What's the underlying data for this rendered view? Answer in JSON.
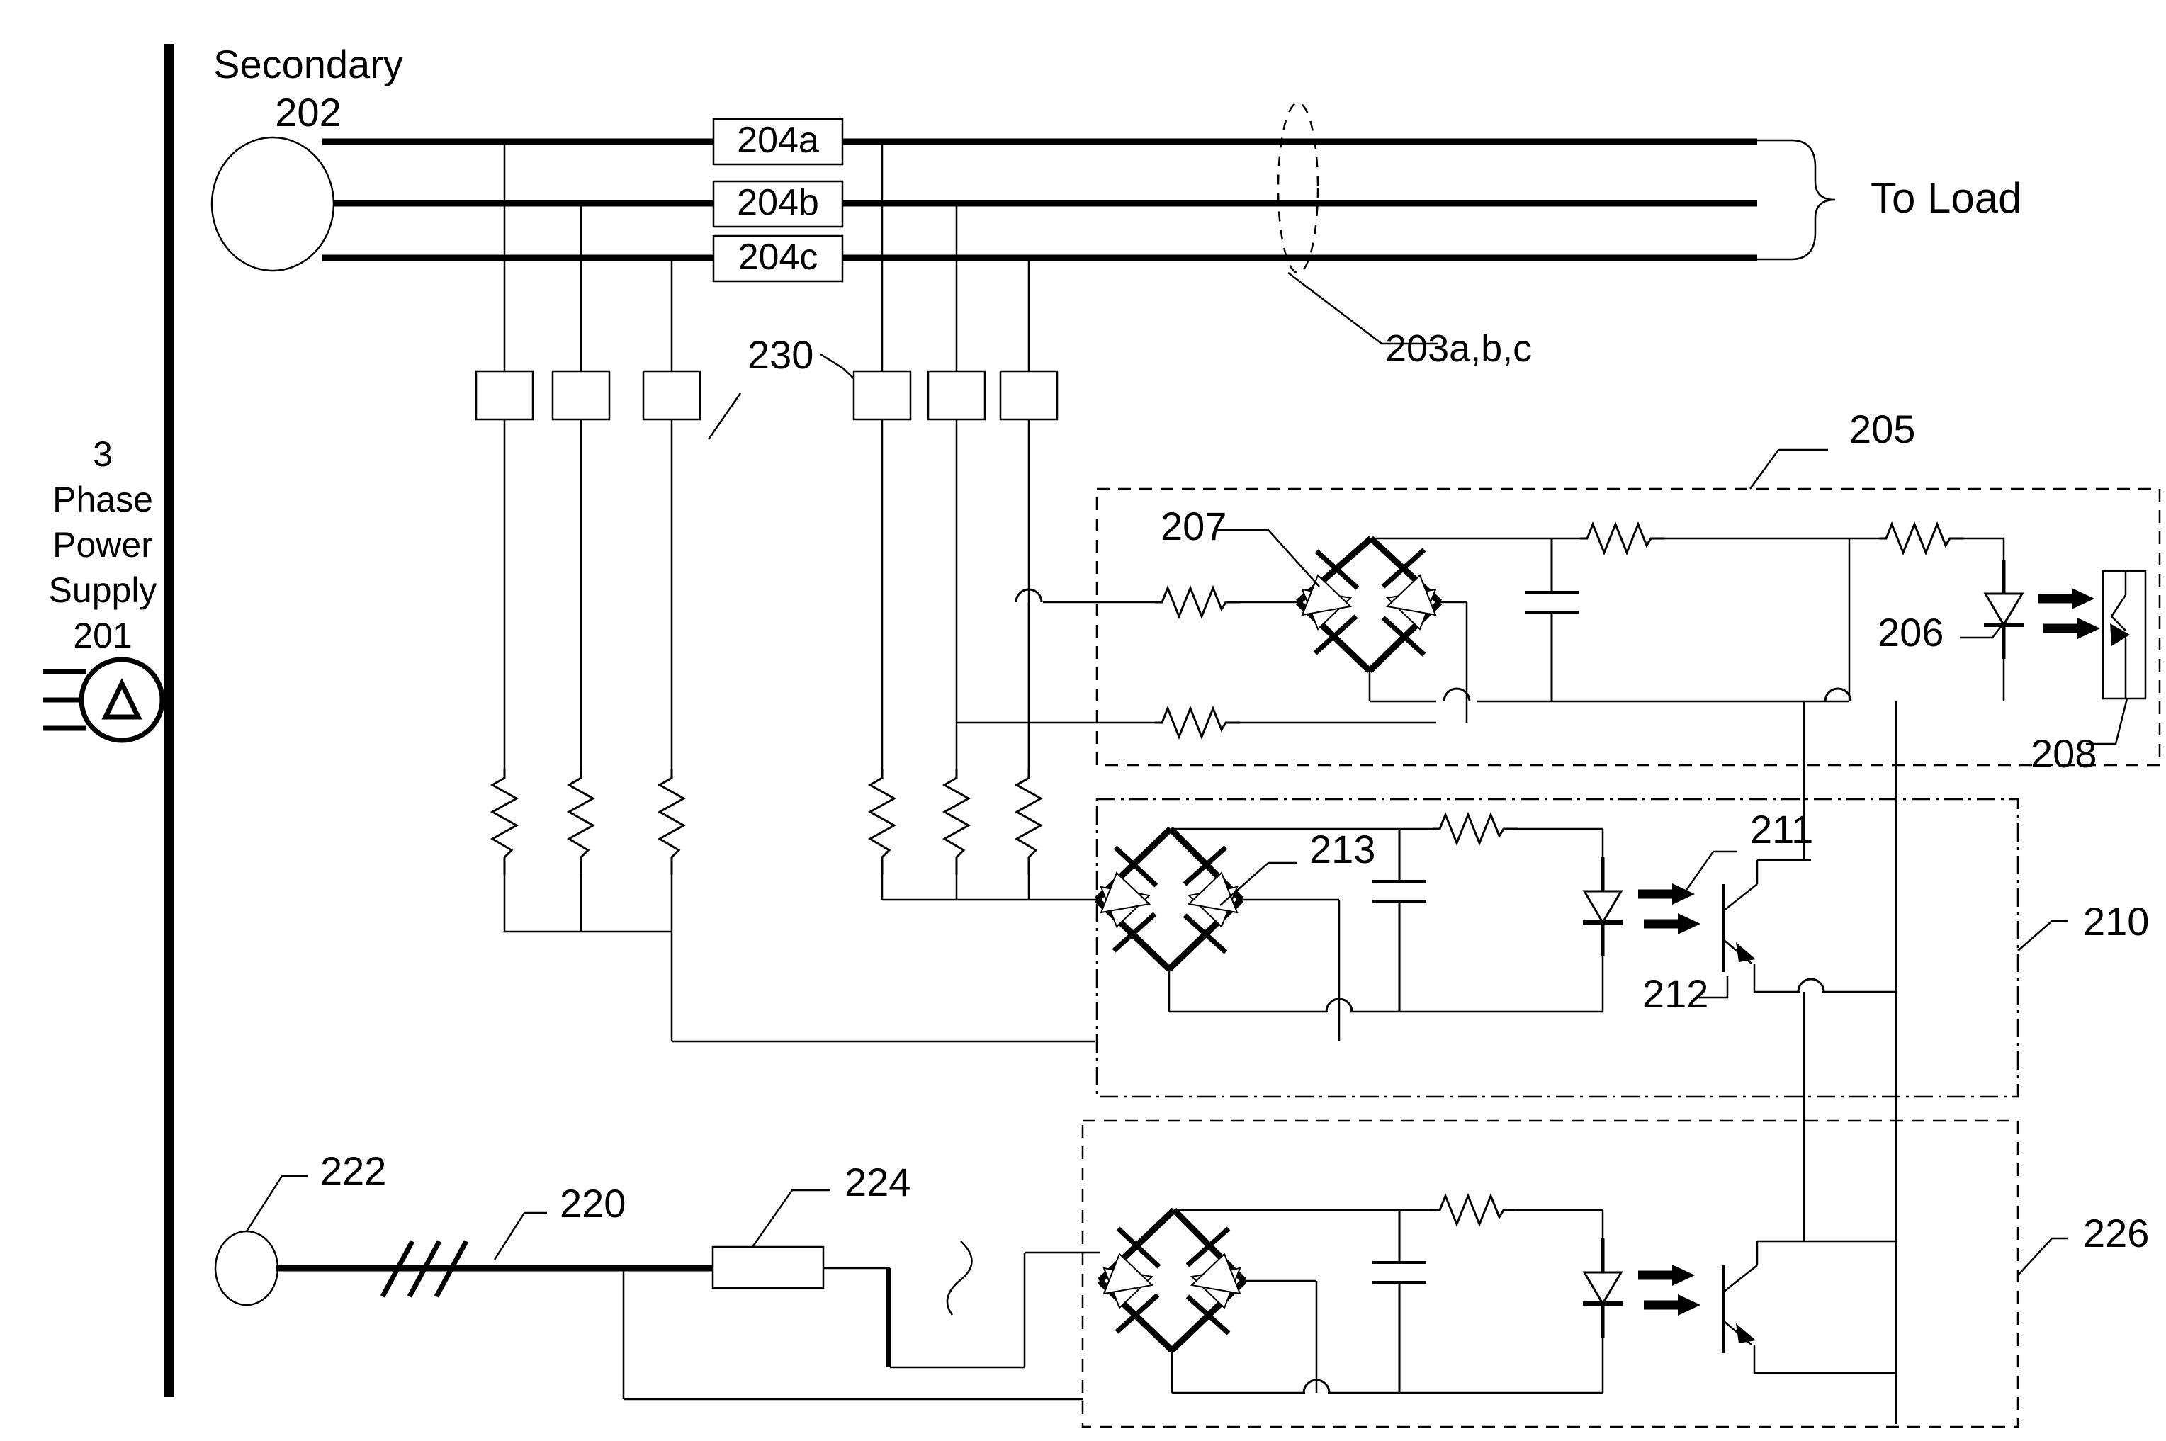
{
  "figure": {
    "type": "patent-circuit-schematic",
    "background": "#ffffff",
    "line_color": "#000000"
  },
  "labels": {
    "secondary_title": "Secondary",
    "secondary_ref": "202",
    "supply_line1": "3",
    "supply_line2": "Phase",
    "supply_line3": "Power",
    "supply_line4": "Supply",
    "supply_ref": "201",
    "phase_a": "204a",
    "phase_b": "204b",
    "phase_c": "204c",
    "conductors_ref": "203a,b,c",
    "to_load": "To Load",
    "ct_ref": "230",
    "block_205": "205",
    "bridge_207": "207",
    "led_206": "206",
    "photo_208": "208",
    "block_210": "210",
    "led_211": "211",
    "photo_212": "212",
    "bridge_213": "213",
    "block_226": "226",
    "source_222": "222",
    "line_220": "220",
    "device_224": "224"
  },
  "icons": {
    "delta_source": "delta-source-icon",
    "diode_bridge": "diode-bridge-icon",
    "capacitor": "capacitor-icon",
    "resistor": "resistor-icon",
    "led": "led-icon",
    "phototransistor": "phototransistor-icon",
    "photo_triac": "photo-triac-icon",
    "current_transformer": "current-transformer-icon",
    "brace": "curly-brace-icon",
    "slash_marks": "three-phase-slash-icon"
  },
  "blocks": [
    {
      "ref": "205",
      "role": "opto-triac-sensing-circuit"
    },
    {
      "ref": "210",
      "role": "opto-transistor-sensing-circuit"
    },
    {
      "ref": "226",
      "role": "opto-transistor-sensing-circuit"
    }
  ],
  "buses": [
    {
      "ref": "204a",
      "name": "phase-a-bus"
    },
    {
      "ref": "204b",
      "name": "phase-b-bus"
    },
    {
      "ref": "204c",
      "name": "phase-c-bus"
    }
  ]
}
